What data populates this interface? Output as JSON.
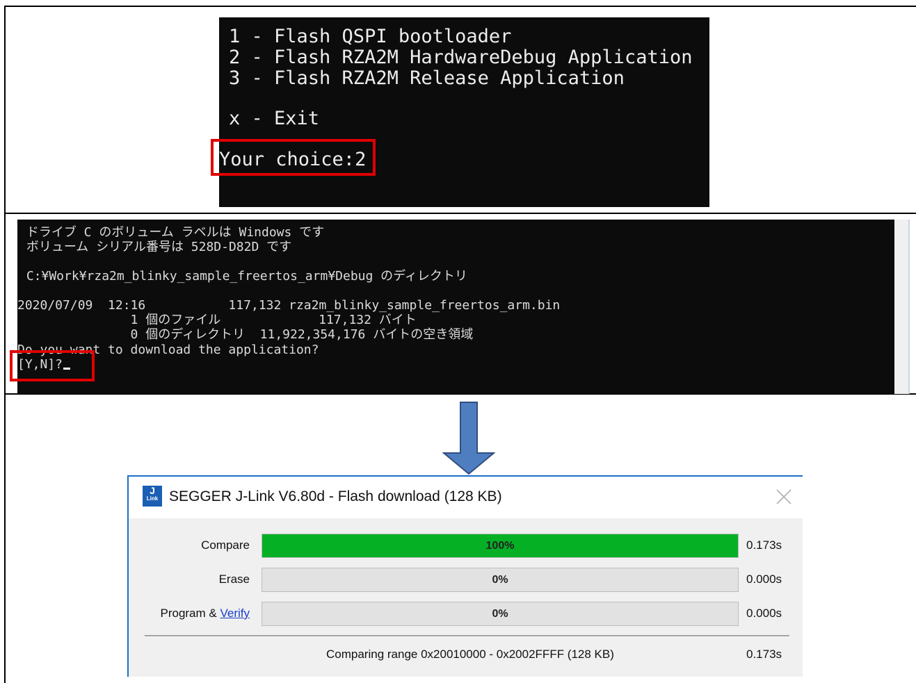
{
  "menu_terminal": {
    "options": [
      "1 - Flash QSPI bootloader",
      "2 - Flash RZA2M HardwareDebug Application",
      "3 - Flash RZA2M Release Application"
    ],
    "exit_option": "x - Exit",
    "prompt": "Your choice:2"
  },
  "dir_terminal": {
    "lines": [
      " ドライブ C のボリューム ラベルは Windows です",
      " ボリューム シリアル番号は 528D-D82D です",
      " C:¥Work¥rza2m_blinky_sample_freertos_arm¥Debug のディレクトリ",
      "2020/07/09  12:16           117,132 rza2m_blinky_sample_freertos_arm.bin",
      "               1 個のファイル             117,132 バイト",
      "               0 個のディレクトリ  11,922,354,176 バイトの空き領域",
      "Do you want to download the application?",
      "[Y,N]?"
    ]
  },
  "dialog": {
    "title": "SEGGER J-Link V6.80d - Flash download (128 KB)",
    "icon_top": "J",
    "icon_bottom": "Link",
    "rows": [
      {
        "label": "Compare",
        "percent_text": "100%",
        "progress": 1.0,
        "time": "0.173s"
      },
      {
        "label": "Erase",
        "percent_text": "0%",
        "progress": 0.0,
        "time": "0.000s"
      },
      {
        "label_prefix": "Program & ",
        "label_link": "Verify",
        "percent_text": "0%",
        "progress": 0.0,
        "time": "0.000s"
      }
    ],
    "status": "Comparing range 0x20010000 - 0x2002FFFF (128 KB)",
    "status_time": "0.173s"
  },
  "colors": {
    "highlight_box": "#e00000",
    "arrow": "#4f7ec0",
    "progress_fill": "#06b025",
    "link": "#1a3dcc"
  }
}
